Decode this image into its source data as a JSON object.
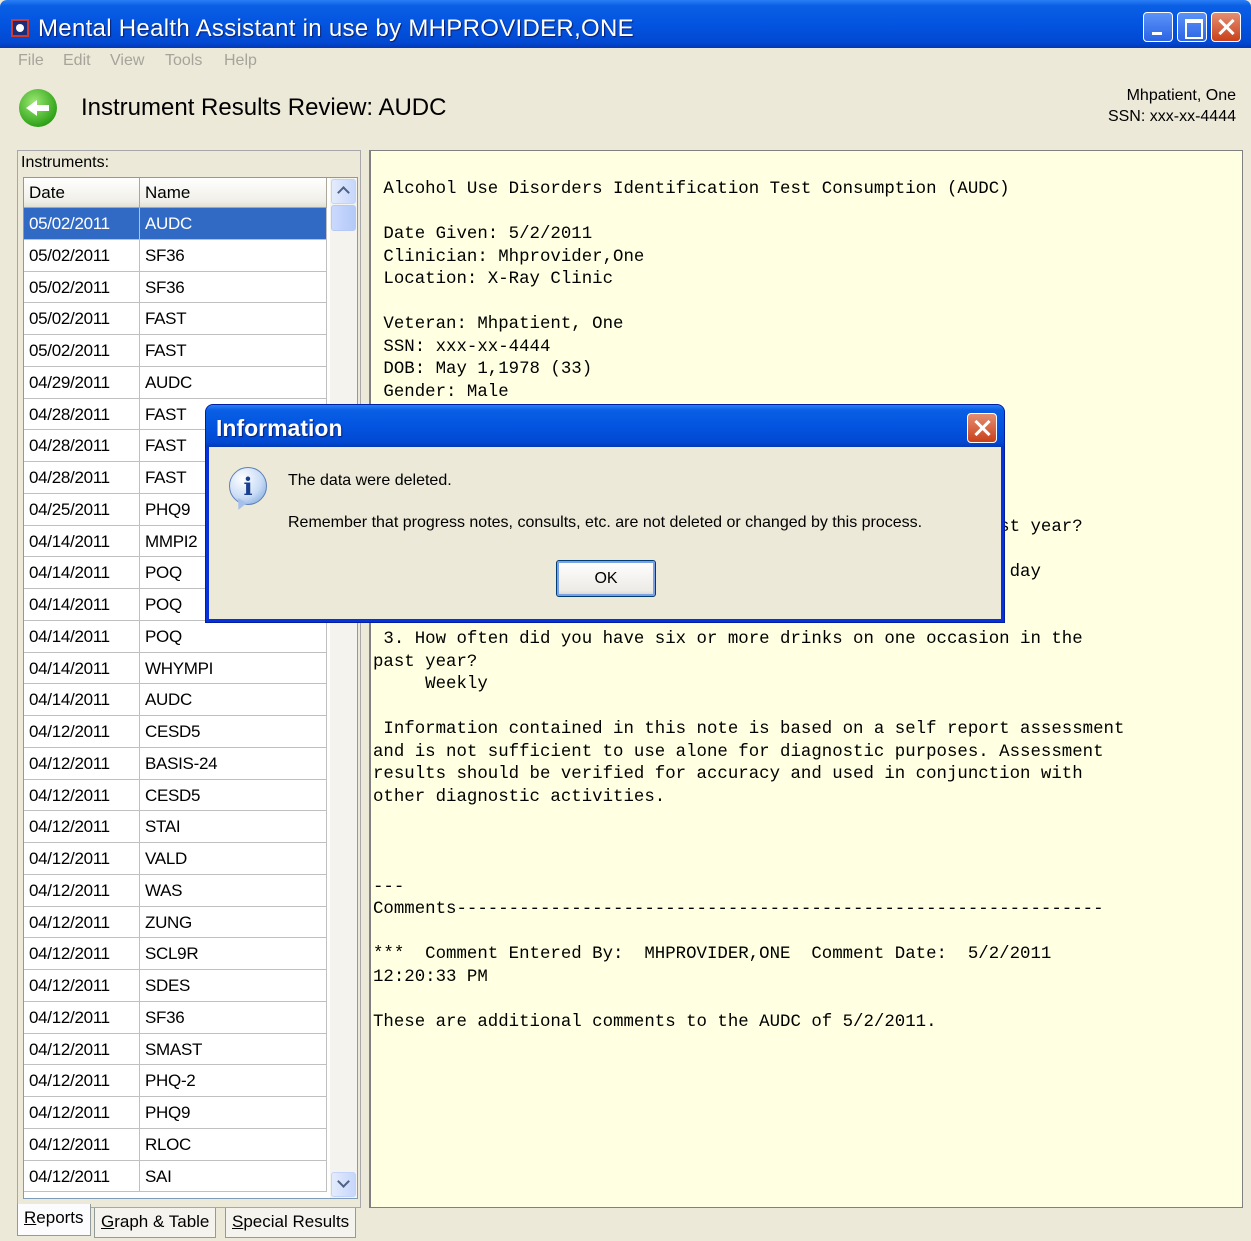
{
  "window": {
    "title": "Mental Health Assistant in use by MHPROVIDER,ONE",
    "menu": [
      "File",
      "Edit",
      "View",
      "Tools",
      "Help"
    ]
  },
  "header": {
    "title": "Instrument Results Review: AUDC",
    "patient_name": "Mhpatient, One",
    "patient_ssn": "SSN: xxx-xx-4444"
  },
  "instruments": {
    "label": "Instruments:",
    "columns": [
      "Date",
      "Name"
    ],
    "rows": [
      {
        "date": "05/02/2011",
        "name": "AUDC"
      },
      {
        "date": "05/02/2011",
        "name": "SF36"
      },
      {
        "date": "05/02/2011",
        "name": "SF36"
      },
      {
        "date": "05/02/2011",
        "name": "FAST"
      },
      {
        "date": "05/02/2011",
        "name": "FAST"
      },
      {
        "date": "04/29/2011",
        "name": "AUDC"
      },
      {
        "date": "04/28/2011",
        "name": "FAST"
      },
      {
        "date": "04/28/2011",
        "name": "FAST"
      },
      {
        "date": "04/28/2011",
        "name": "FAST"
      },
      {
        "date": "04/25/2011",
        "name": "PHQ9"
      },
      {
        "date": "04/14/2011",
        "name": "MMPI2"
      },
      {
        "date": "04/14/2011",
        "name": "POQ"
      },
      {
        "date": "04/14/2011",
        "name": "POQ"
      },
      {
        "date": "04/14/2011",
        "name": "POQ"
      },
      {
        "date": "04/14/2011",
        "name": "WHYMPI"
      },
      {
        "date": "04/14/2011",
        "name": "AUDC"
      },
      {
        "date": "04/12/2011",
        "name": "CESD5"
      },
      {
        "date": "04/12/2011",
        "name": "BASIS-24"
      },
      {
        "date": "04/12/2011",
        "name": "CESD5"
      },
      {
        "date": "04/12/2011",
        "name": "STAI"
      },
      {
        "date": "04/12/2011",
        "name": "VALD"
      },
      {
        "date": "04/12/2011",
        "name": "WAS"
      },
      {
        "date": "04/12/2011",
        "name": "ZUNG"
      },
      {
        "date": "04/12/2011",
        "name": "SCL9R"
      },
      {
        "date": "04/12/2011",
        "name": "SDES"
      },
      {
        "date": "04/12/2011",
        "name": "SF36"
      },
      {
        "date": "04/12/2011",
        "name": "SMAST"
      },
      {
        "date": "04/12/2011",
        "name": "PHQ-2"
      },
      {
        "date": "04/12/2011",
        "name": "PHQ9"
      },
      {
        "date": "04/12/2011",
        "name": "RLOC"
      },
      {
        "date": "04/12/2011",
        "name": "SAI"
      }
    ],
    "selected_index": 0
  },
  "report": {
    "text": " Alcohol Use Disorders Identification Test Consumption (AUDC)\n\n Date Given: 5/2/2011\n Clinician: Mhprovider,One\n Location: X-Ray Clinic\n\n Veteran: Mhpatient, One\n SSN: xxx-xx-4444\n DOB: May 1,1978 (33)\n Gender: Male\n\n\n\n\n\n                                                   in the past year?\n\n                                                 n a typical day\n\n      5 or 6\n 3. How often did you have six or more drinks on one occasion in the\npast year?\n     Weekly\n\n Information contained in this note is based on a self report assessment\nand is not sufficient to use alone for diagnostic purposes. Assessment\nresults should be verified for accuracy and used in conjunction with\nother diagnostic activities.\n\n\n\n---\nComments--------------------------------------------------------------\n\n***  Comment Entered By:  MHPROVIDER,ONE  Comment Date:  5/2/2011\n12:20:33 PM\n\nThese are additional comments to the AUDC of 5/2/2011."
  },
  "tabs": [
    {
      "label": "Reports",
      "underline": "R",
      "rest": "eports",
      "active": true
    },
    {
      "label": "Graph & Table",
      "underline": "G",
      "rest": "raph & Table",
      "active": false
    },
    {
      "label": "Special Results",
      "underline": "S",
      "rest": "pecial Results",
      "active": false
    }
  ],
  "dialog": {
    "title": "Information",
    "message": "The data were deleted.",
    "detail": "Remember that progress notes, consults, etc. are not deleted or changed by this process.",
    "ok_label": "OK",
    "icon": "info-icon"
  },
  "colors": {
    "selection": "#316ac5",
    "report_background": "#ffffe1",
    "titlebar": "#0354e0"
  }
}
